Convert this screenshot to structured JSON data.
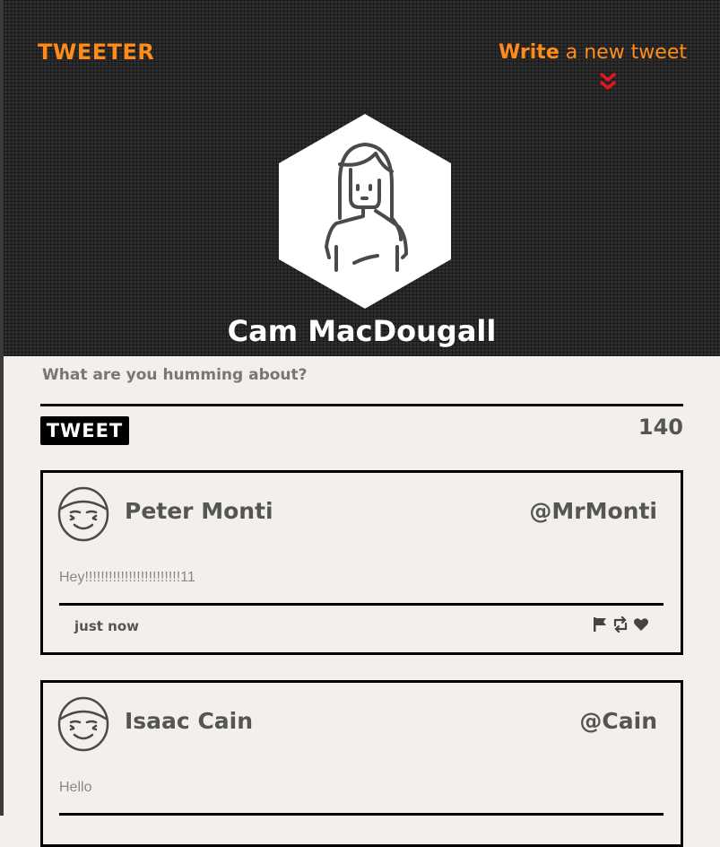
{
  "header": {
    "brand": "TWEETER",
    "write_bold": "Write",
    "write_rest": " a new tweet",
    "user_name": "Cam MacDougall"
  },
  "compose": {
    "placeholder": "What are you humming about?",
    "tweet_button": "TWEET",
    "char_count": "140"
  },
  "tweets": [
    {
      "name": "Peter Monti",
      "handle": "@MrMonti",
      "text": "Hey!!!!!!!!!!!!!!!!!!!!!!!!11",
      "time": "just now"
    },
    {
      "name": "Isaac Cain",
      "handle": "@Cain",
      "text": "Hello"
    }
  ],
  "icons": {
    "chevron": "double-chevron-down-icon",
    "flag": "flag-icon",
    "retweet": "retweet-icon",
    "like": "heart-icon"
  },
  "colors": {
    "accent": "#ff8c1a",
    "header_bg": "#2d2d2d",
    "page_bg": "#f3f0eb",
    "chevron": "#e8141c"
  }
}
